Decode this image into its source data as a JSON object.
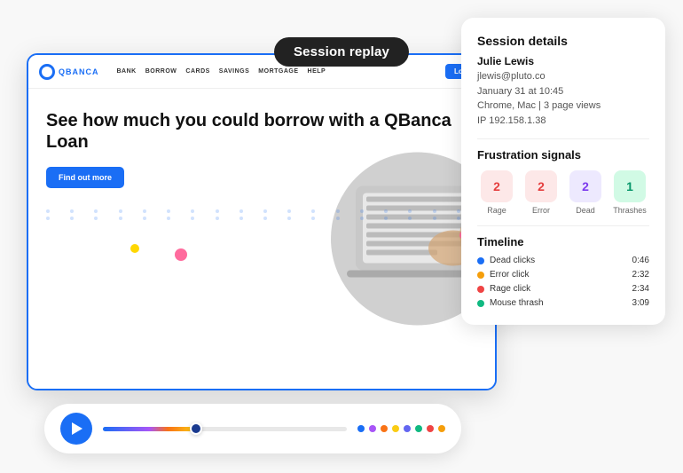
{
  "scene": {
    "background": "#f5f5f5"
  },
  "session_replay_label": "Session replay",
  "browser": {
    "logo_text": "QBANCA",
    "nav_links": [
      "BANK",
      "BORROW",
      "CARDS",
      "SAVINGS",
      "MORTGAGE",
      "HELP"
    ],
    "login_label": "Log in",
    "hero_title": "See how much you could borrow with a QBanca Loan",
    "cta_label": "Find out more"
  },
  "session_details": {
    "section_title": "Session details",
    "user_name": "Julie Lewis",
    "user_email": "jlewis@pluto.co",
    "session_date": "January 31 at 10:45",
    "session_meta": "Chrome, Mac | 3 page views",
    "ip": "IP 192.158.1.38",
    "frustration_title": "Frustration signals",
    "signals": [
      {
        "count": "2",
        "label": "Rage",
        "type": "rage"
      },
      {
        "count": "2",
        "label": "Error",
        "type": "error"
      },
      {
        "count": "2",
        "label": "Dead",
        "type": "dead"
      },
      {
        "count": "1",
        "label": "Thrashes",
        "type": "thrash"
      }
    ],
    "timeline_title": "Timeline",
    "timeline_items": [
      {
        "label": "Dead clicks",
        "time": "0:46",
        "color": "#1a6ef5"
      },
      {
        "label": "Error click",
        "time": "2:32",
        "color": "#f59e0b"
      },
      {
        "label": "Rage click",
        "time": "2:34",
        "color": "#ef4444"
      },
      {
        "label": "Mouse thrash",
        "time": "3:09",
        "color": "#10b981"
      }
    ]
  },
  "playback": {
    "progress_dots": [
      "#1a6ef5",
      "#a855f7",
      "#f97316",
      "#facc15",
      "#6366f1",
      "#10b981",
      "#ef4444",
      "#f59e0b"
    ]
  }
}
